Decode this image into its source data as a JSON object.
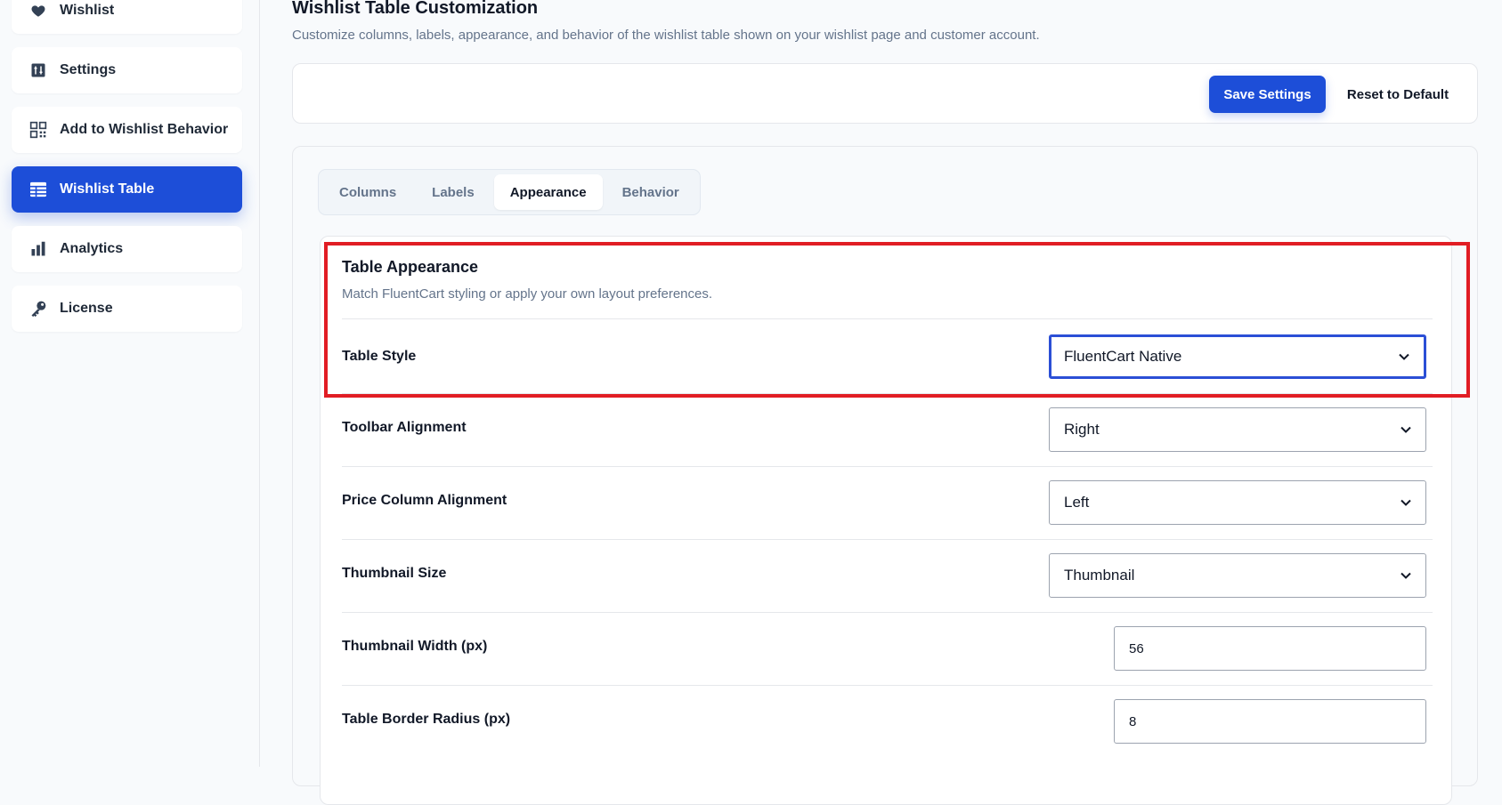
{
  "sidebar": {
    "items": [
      {
        "label": "Wishlist",
        "icon": "heart-icon",
        "active": false
      },
      {
        "label": "Settings",
        "icon": "settings-icon",
        "active": false
      },
      {
        "label": "Add to Wishlist Behavior",
        "icon": "grid-icon",
        "active": false
      },
      {
        "label": "Wishlist Table",
        "icon": "table-icon",
        "active": true
      },
      {
        "label": "Analytics",
        "icon": "bar-chart-icon",
        "active": false
      },
      {
        "label": "License",
        "icon": "key-icon",
        "active": false
      }
    ]
  },
  "page": {
    "title": "Wishlist Table Customization",
    "description": "Customize columns, labels, appearance, and behavior of the wishlist table shown on your wishlist page and customer account."
  },
  "toolbar": {
    "save_label": "Save Settings",
    "reset_label": "Reset to Default"
  },
  "tabs": [
    {
      "label": "Columns",
      "active": false
    },
    {
      "label": "Labels",
      "active": false
    },
    {
      "label": "Appearance",
      "active": true
    },
    {
      "label": "Behavior",
      "active": false
    }
  ],
  "appearance": {
    "title": "Table Appearance",
    "subtitle": "Match FluentCart styling or apply your own layout preferences.",
    "rows": [
      {
        "label": "Table Style",
        "type": "select",
        "value": "FluentCart Native"
      },
      {
        "label": "Toolbar Alignment",
        "type": "select",
        "value": "Right"
      },
      {
        "label": "Price Column Alignment",
        "type": "select",
        "value": "Left"
      },
      {
        "label": "Thumbnail Size",
        "type": "select",
        "value": "Thumbnail"
      },
      {
        "label": "Thumbnail Width (px)",
        "type": "number",
        "value": "56"
      },
      {
        "label": "Table Border Radius (px)",
        "type": "number",
        "value": "8"
      }
    ]
  },
  "colors": {
    "accent": "#1d4ed8",
    "highlight": "#e11d24"
  }
}
